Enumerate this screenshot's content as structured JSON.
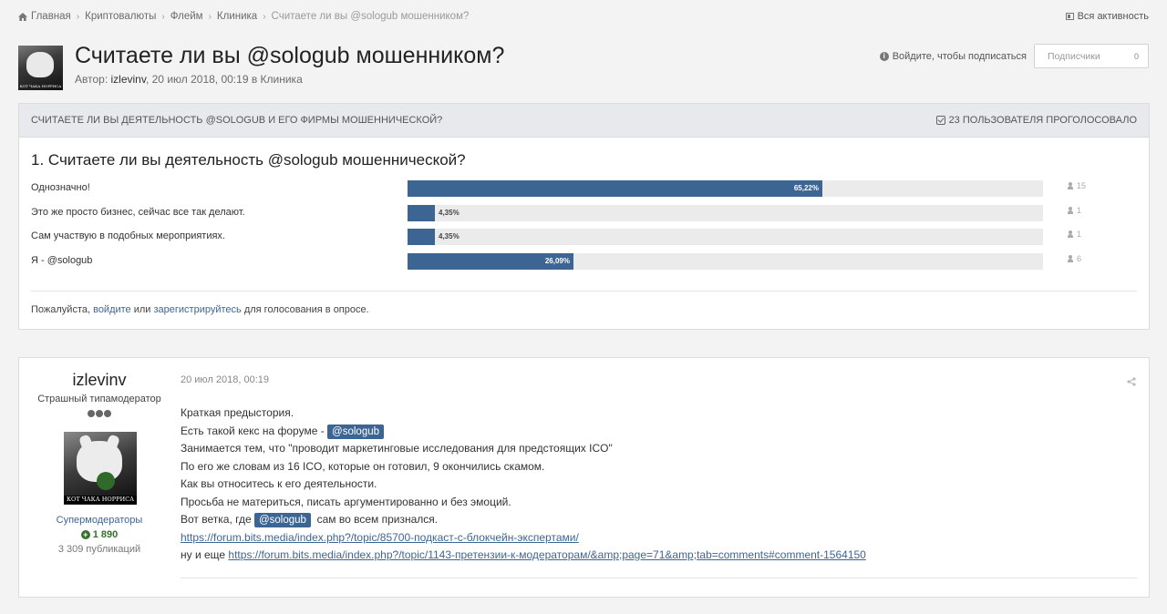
{
  "breadcrumbs": [
    {
      "label": "Главная"
    },
    {
      "label": "Криптовалюты"
    },
    {
      "label": "Флейм"
    },
    {
      "label": "Клиника"
    },
    {
      "label": "Считаете ли вы @sologub мошенником?"
    }
  ],
  "activity_label": "Вся активность",
  "topic": {
    "title": "Считаете ли вы @sologub мошенником?",
    "meta_prefix": "Автор: ",
    "author": "izlevinv",
    "meta_suffix": ", 20 июл 2018, 00:19 в Клиника",
    "avatar_caption": "КОТ ЧАКА НОРРИСА"
  },
  "follow": {
    "login_text": "Войдите, чтобы подписаться",
    "subscribers_label": "Подписчики",
    "subscribers_count": "0"
  },
  "poll": {
    "header": "Считаете ли вы деятельность @sologub и его фирмы мошеннической?",
    "votes_text": "23 пользователя проголосовало",
    "question": "1. Считаете ли вы деятельность @sologub мошеннической?",
    "options": [
      {
        "label": "Однозначно!",
        "percent": 65.22,
        "percent_text": "65,22%",
        "count": "15"
      },
      {
        "label": "Это же просто бизнес, сейчас все так делают.",
        "percent": 4.35,
        "percent_text": "4,35%",
        "count": "1"
      },
      {
        "label": "Сам участвую в подобных мероприятиях.",
        "percent": 4.35,
        "percent_text": "4,35%",
        "count": "1"
      },
      {
        "label": "Я - @sologub",
        "percent": 26.09,
        "percent_text": "26,09%",
        "count": "6"
      }
    ],
    "note_prefix": "Пожалуйста, ",
    "note_login": "войдите",
    "note_middle": " или ",
    "note_register": "зарегистрируйтесь",
    "note_suffix": " для голосования в опросе.",
    "bar_color": "#3d6594"
  },
  "post": {
    "username": "izlevinv",
    "rank": "Страшный типамодератор",
    "avatar_caption": "КОТ ЧАКА НОРРИСА",
    "group": "Супермодераторы",
    "reputation": "1 890",
    "post_count": "3 309 публикаций",
    "date": "20 июл 2018, 00:19",
    "lines": {
      "l1": "Краткая предыстория.",
      "l2": "Есть такой кекс на форуме - ",
      "mention": "@sologub",
      "l3": "Занимается тем, что \"проводит маркетинговые исследования для предстоящих ICO\"",
      "l4": "По его же словам из 16 ICO, которые он готовил, 9 окончились скамом.",
      "l5": "Как вы относитесь к его деятельности.",
      "l6": "Просьба не материться, писать аргументированно и без эмоций.",
      "l7a": "Вот ветка, где ",
      "l7b": "  сам во всем признался.",
      "link1": "https://forum.bits.media/index.php?/topic/85700-подкаст-с-блокчейн-экспертами/",
      "l9": "ну и еще ",
      "link2": "https://forum.bits.media/index.php?/topic/1143-претензии-к-модераторам/&amp;page=71&amp;tab=comments#comment-1564150"
    }
  }
}
